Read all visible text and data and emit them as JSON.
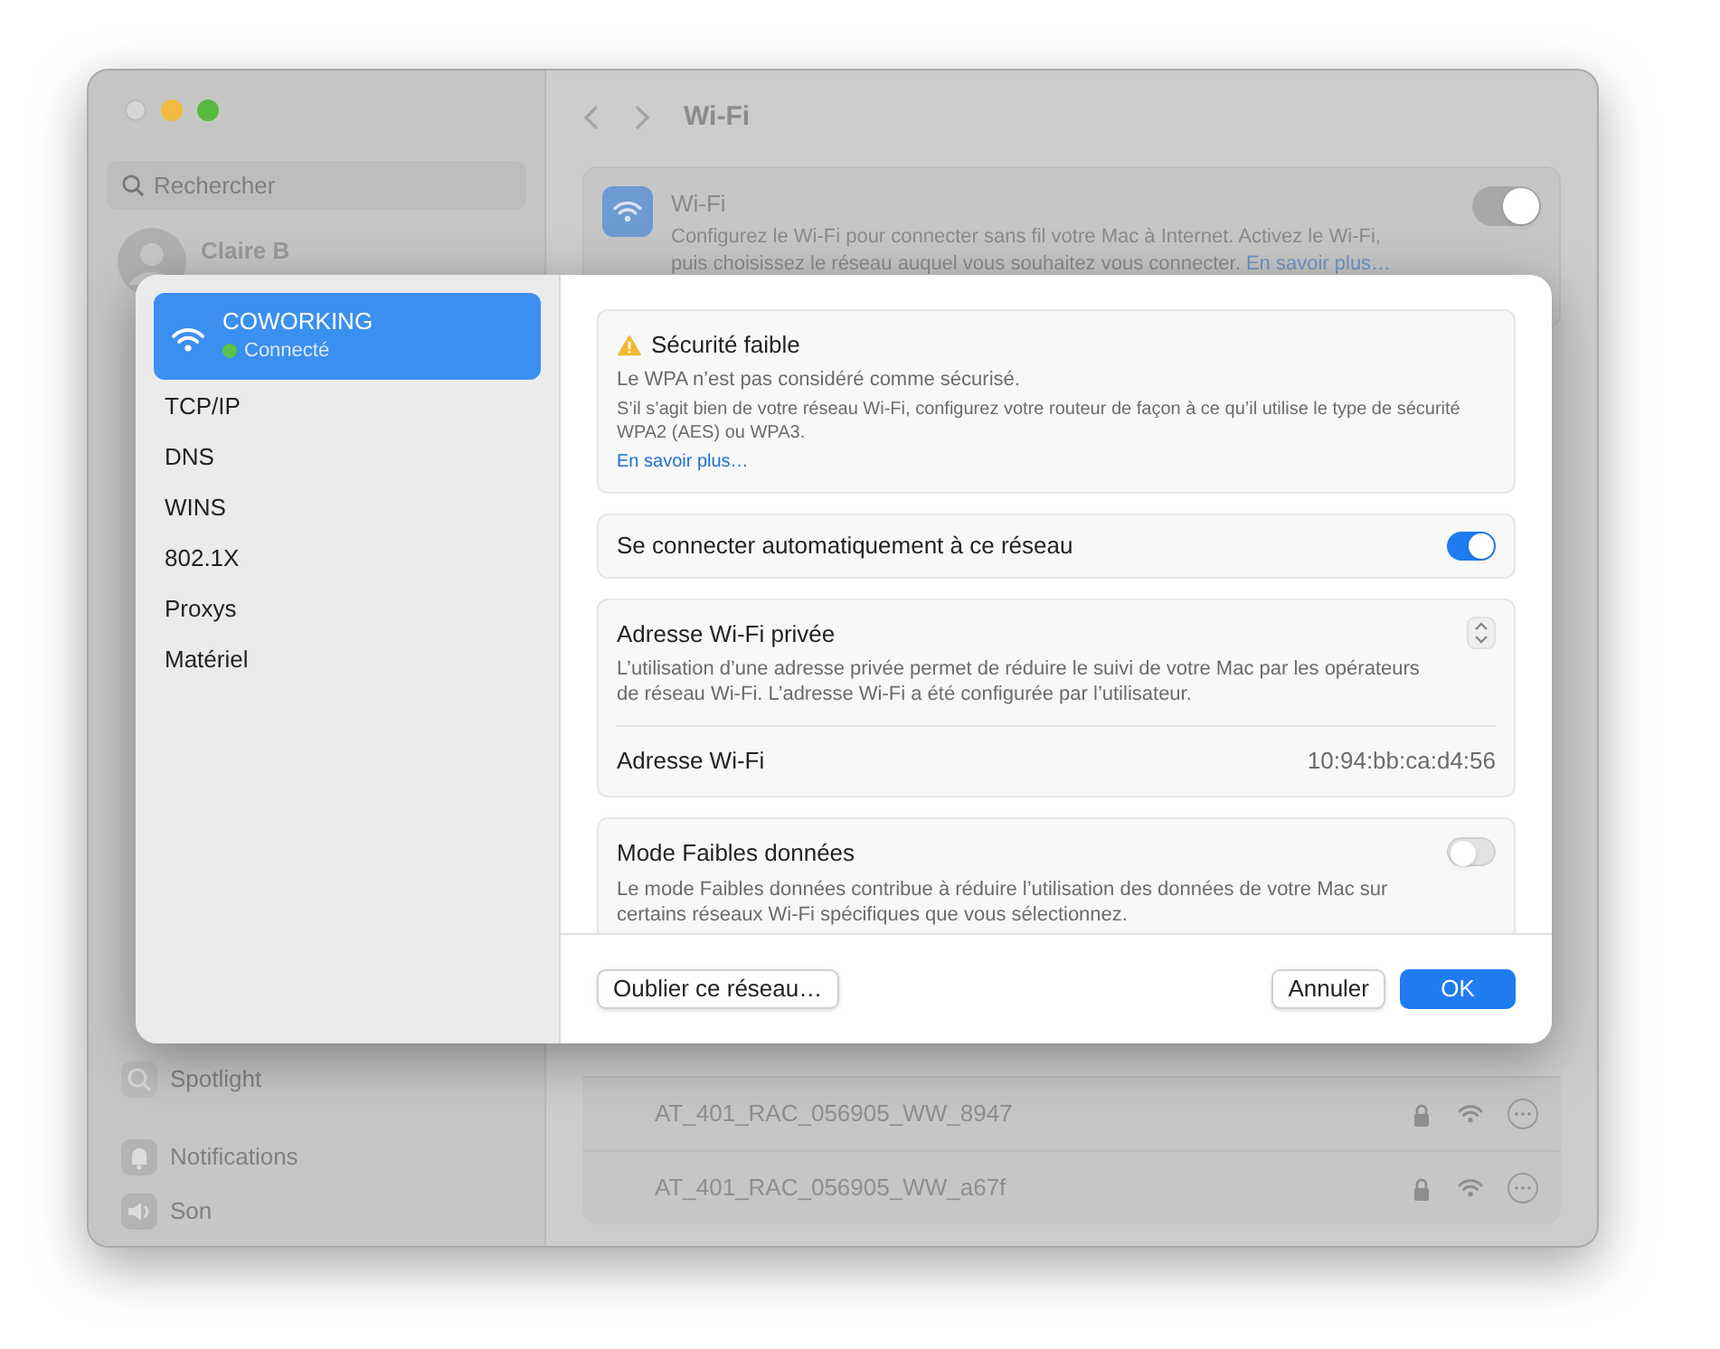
{
  "window": {
    "title": "Wi-Fi"
  },
  "sidebar": {
    "search": {
      "placeholder": "Rechercher"
    },
    "user": "Claire B",
    "items": [
      {
        "label": "Spotlight",
        "kind": "search"
      },
      {
        "label": "Notifications",
        "kind": "bell"
      },
      {
        "label": "Son",
        "kind": "speaker"
      }
    ]
  },
  "wifi_card": {
    "title": "Wi-Fi",
    "description": "Configurez le Wi-Fi pour connecter sans fil votre Mac à Internet. Activez le Wi-Fi, puis choisissez le réseau auquel vous souhaitez vous connecter.",
    "link": "En savoir plus…",
    "on": true
  },
  "networks": [
    {
      "name": "AT_401_RAC_056905_WW_8947"
    },
    {
      "name": "AT_401_RAC_056905_WW_a67f"
    }
  ],
  "sheet": {
    "network": {
      "name": "COWORKING",
      "status": "Connecté",
      "color": "#5ac34a",
      "selected": true
    },
    "tabs": [
      {
        "label": "TCP/IP",
        "selected": false
      },
      {
        "label": "DNS",
        "selected": false
      },
      {
        "label": "WINS",
        "selected": false
      },
      {
        "label": "802.1X",
        "selected": false
      },
      {
        "label": "Proxys",
        "selected": false
      },
      {
        "label": "Matériel",
        "selected": false
      }
    ],
    "warning": {
      "title": "Sécurité faible",
      "line1": "Le WPA n’est pas considéré comme sécurisé.",
      "line2": "S’il s’agit bien de votre réseau Wi-Fi, configurez votre routeur de façon à ce qu’il utilise le type de sécurité WPA2 (AES) ou WPA3.",
      "link": "En savoir plus…"
    },
    "auto_join": {
      "label": "Se connecter automatiquement à ce réseau",
      "on": true
    },
    "private_address": {
      "title": "Adresse Wi-Fi privée",
      "description": "L’utilisation d’une adresse privée permet de réduire le suivi de votre Mac par les opérateurs de réseau Wi-Fi. L’adresse Wi-Fi a été configurée par l’utilisateur.",
      "address_label": "Adresse Wi-Fi",
      "address": "10:94:bb:ca:d4:56"
    },
    "low_data": {
      "title": "Mode Faibles données",
      "description": "Le mode Faibles données contribue à réduire l’utilisation des données de votre Mac sur certains réseaux Wi-Fi spécifiques que vous sélectionnez.",
      "on": false
    },
    "buttons": {
      "forget": "Oublier ce réseau…",
      "cancel": "Annuler",
      "ok": "OK"
    }
  }
}
